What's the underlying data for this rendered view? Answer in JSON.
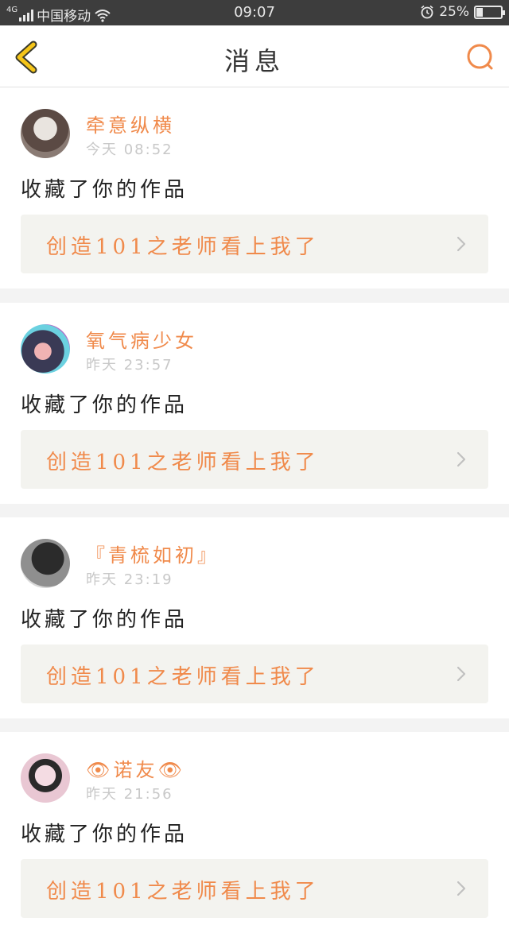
{
  "status_bar": {
    "network": "4G",
    "carrier": "中国移动",
    "time": "09:07",
    "battery_text": "25%",
    "battery_level": 0.25,
    "icons": [
      "signal-icon",
      "wifi-icon",
      "alarm-icon",
      "battery-icon"
    ]
  },
  "nav": {
    "title": "消息",
    "back_icon": "chevron-left-icon",
    "search_icon": "search-icon"
  },
  "colors": {
    "accent": "#f08a4b",
    "back_yellow": "#f5c518",
    "card_bg": "#ffffff",
    "work_bg": "#f3f3ef",
    "page_bg": "#f3f3f3"
  },
  "messages": [
    {
      "name": "牵意纵横",
      "time": "今天 08:52",
      "action": "收藏了你的作品",
      "work": "创造101之老师看上我了"
    },
    {
      "name": "氧气病少女",
      "time": "昨天 23:57",
      "action": "收藏了你的作品",
      "work": "创造101之老师看上我了"
    },
    {
      "name": "『青梳如初』",
      "time": "昨天 23:19",
      "action": "收藏了你的作品",
      "work": "创造101之老师看上我了"
    },
    {
      "name": "👁诺友👁",
      "time": "昨天 21:56",
      "action": "收藏了你的作品",
      "work": "创造101之老师看上我了"
    }
  ]
}
